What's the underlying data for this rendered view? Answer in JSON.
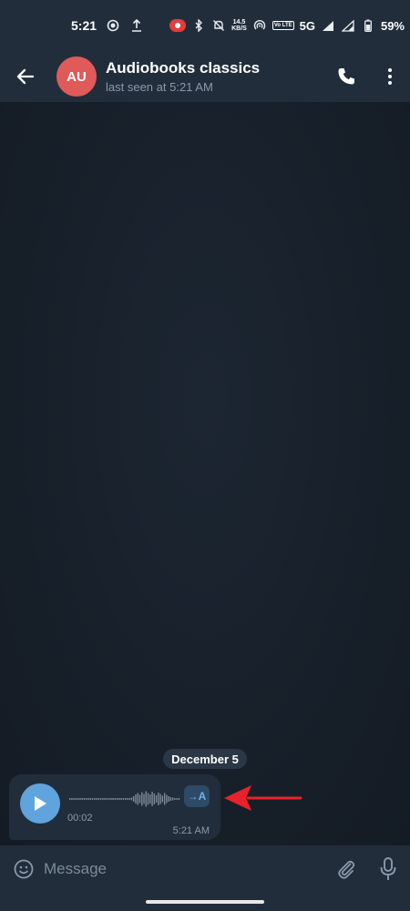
{
  "status_bar": {
    "time": "5:21",
    "net_speed_value": "14.5",
    "net_speed_unit": "KB/S",
    "volte_label": "Vo LTE",
    "network": "5G",
    "battery": "59%"
  },
  "header": {
    "avatar_initials": "AU",
    "title": "Audiobooks classics",
    "subtitle": "last seen at 5:21 AM"
  },
  "chat": {
    "date_chip": "December 5",
    "voice_message": {
      "duration": "00:02",
      "time": "5:21 AM",
      "transcribe_label": "→A"
    }
  },
  "input": {
    "placeholder": "Message"
  },
  "colors": {
    "accent": "#5fa4dc",
    "avatar": "#e05a5a",
    "annotation_arrow": "#e8222a"
  }
}
